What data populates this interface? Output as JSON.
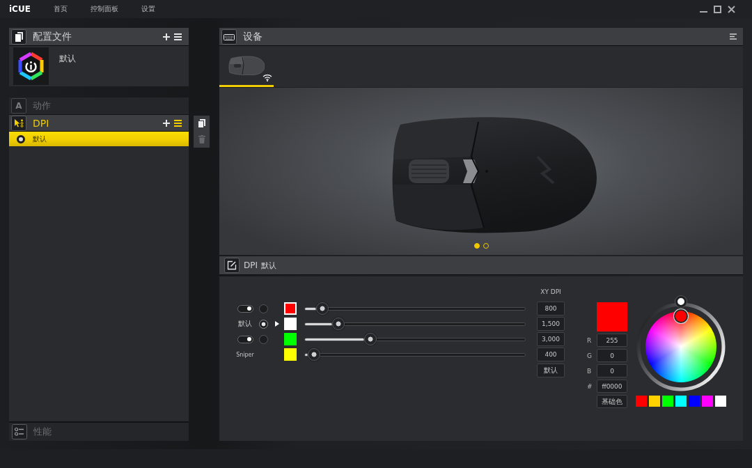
{
  "window": {
    "app_name": "iCUE",
    "nav": [
      {
        "label": "首页"
      },
      {
        "label": "控制面板"
      },
      {
        "label": "设置"
      }
    ]
  },
  "profiles": {
    "title": "配置文件",
    "items": [
      {
        "name": "默认"
      }
    ]
  },
  "actions": {
    "icon": "A",
    "title": "动作"
  },
  "dpi_list": {
    "title": "DPI",
    "items": [
      {
        "name": "默认",
        "selected": true
      }
    ]
  },
  "side_tools": [
    {
      "kind": "copy",
      "disabled": false
    },
    {
      "kind": "delete",
      "disabled": true
    }
  ],
  "performance": {
    "title": "性能"
  },
  "devices": {
    "title": "设备",
    "tabs": [
      {
        "kind": "mouse",
        "wireless": true,
        "selected": true
      }
    ]
  },
  "carousel": [
    {
      "selected": true
    },
    {
      "selected": false
    }
  ],
  "dpi_editor": {
    "title": "DPI",
    "profile": "默认",
    "column_header": "XY DPI",
    "stages": [
      {
        "kind": "stage",
        "on": true,
        "selected": false,
        "color": "#ff0000",
        "outlined": true,
        "level": 0.04,
        "value": "800"
      },
      {
        "kind": "default",
        "label": "默认",
        "selected": true,
        "color": "#ffffff",
        "outlined": false,
        "level": 0.12,
        "value": "1,500"
      },
      {
        "kind": "stage",
        "on": true,
        "selected": false,
        "color": "#00ff00",
        "outlined": false,
        "level": 0.28,
        "value": "3,000"
      },
      {
        "kind": "sniper",
        "label": "Sniper",
        "selected": false,
        "color": "#ffff00",
        "outlined": false,
        "level": 0,
        "value": "400"
      }
    ],
    "reset_button": "默认"
  },
  "color_picker": {
    "color": "#ff0000",
    "fields": [
      {
        "label": "R",
        "value": "255"
      },
      {
        "label": "G",
        "value": "0"
      },
      {
        "label": "B",
        "value": "0"
      },
      {
        "label": "#",
        "value": "ff0000"
      }
    ],
    "button": "基础色",
    "presets": [
      {
        "color": "#ff0000"
      },
      {
        "color": "#ffd200"
      },
      {
        "color": "#00ff00"
      },
      {
        "color": "#00ffff"
      },
      {
        "color": "#0000ff"
      },
      {
        "color": "#ff00ff"
      },
      {
        "color": "#ffffff"
      }
    ]
  }
}
